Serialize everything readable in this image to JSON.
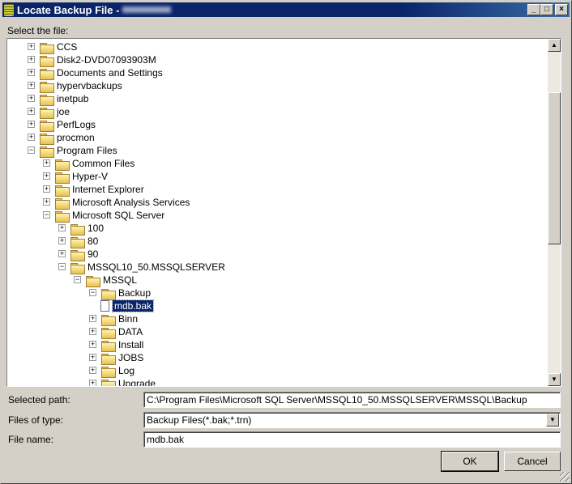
{
  "window": {
    "title": "Locate Backup File - "
  },
  "labels": {
    "select": "Select the file:",
    "selected_path": "Selected path:",
    "files_of_type": "Files of type:",
    "file_name": "File name:"
  },
  "tree": [
    {
      "label": "CCS",
      "level": 0,
      "state": "collapsed"
    },
    {
      "label": "Disk2-DVD07093903M",
      "level": 0,
      "state": "collapsed"
    },
    {
      "label": "Documents and Settings",
      "level": 0,
      "state": "collapsed"
    },
    {
      "label": "hypervbackups",
      "level": 0,
      "state": "collapsed"
    },
    {
      "label": "inetpub",
      "level": 0,
      "state": "collapsed"
    },
    {
      "label": "joe",
      "level": 0,
      "state": "collapsed"
    },
    {
      "label": "PerfLogs",
      "level": 0,
      "state": "collapsed"
    },
    {
      "label": "procmon",
      "level": 0,
      "state": "collapsed"
    },
    {
      "label": "Program Files",
      "level": 0,
      "state": "expanded"
    },
    {
      "label": "Common Files",
      "level": 1,
      "state": "collapsed"
    },
    {
      "label": "Hyper-V",
      "level": 1,
      "state": "collapsed"
    },
    {
      "label": "Internet Explorer",
      "level": 1,
      "state": "collapsed"
    },
    {
      "label": "Microsoft Analysis Services",
      "level": 1,
      "state": "collapsed"
    },
    {
      "label": "Microsoft SQL Server",
      "level": 1,
      "state": "expanded"
    },
    {
      "label": "100",
      "level": 2,
      "state": "collapsed"
    },
    {
      "label": "80",
      "level": 2,
      "state": "collapsed"
    },
    {
      "label": "90",
      "level": 2,
      "state": "collapsed"
    },
    {
      "label": "MSSQL10_50.MSSQLSERVER",
      "level": 2,
      "state": "expanded"
    },
    {
      "label": "MSSQL",
      "level": 3,
      "state": "expanded"
    },
    {
      "label": "Backup",
      "level": 4,
      "state": "expanded"
    },
    {
      "label": "mdb.bak",
      "level": 5,
      "state": "file",
      "selected": true
    },
    {
      "label": "Binn",
      "level": 4,
      "state": "collapsed"
    },
    {
      "label": "DATA",
      "level": 4,
      "state": "collapsed"
    },
    {
      "label": "Install",
      "level": 4,
      "state": "collapsed"
    },
    {
      "label": "JOBS",
      "level": 4,
      "state": "collapsed"
    },
    {
      "label": "Log",
      "level": 4,
      "state": "collapsed"
    },
    {
      "label": "Upgrade",
      "level": 4,
      "state": "collapsed"
    }
  ],
  "fields": {
    "selected_path": "C:\\Program Files\\Microsoft SQL Server\\MSSQL10_50.MSSQLSERVER\\MSSQL\\Backup",
    "files_of_type": "Backup Files(*.bak;*.trn)",
    "file_name": "mdb.bak"
  },
  "buttons": {
    "ok": "OK",
    "cancel": "Cancel"
  },
  "scroll": {
    "position_fraction": 0.05,
    "visible_fraction": 0.55
  }
}
